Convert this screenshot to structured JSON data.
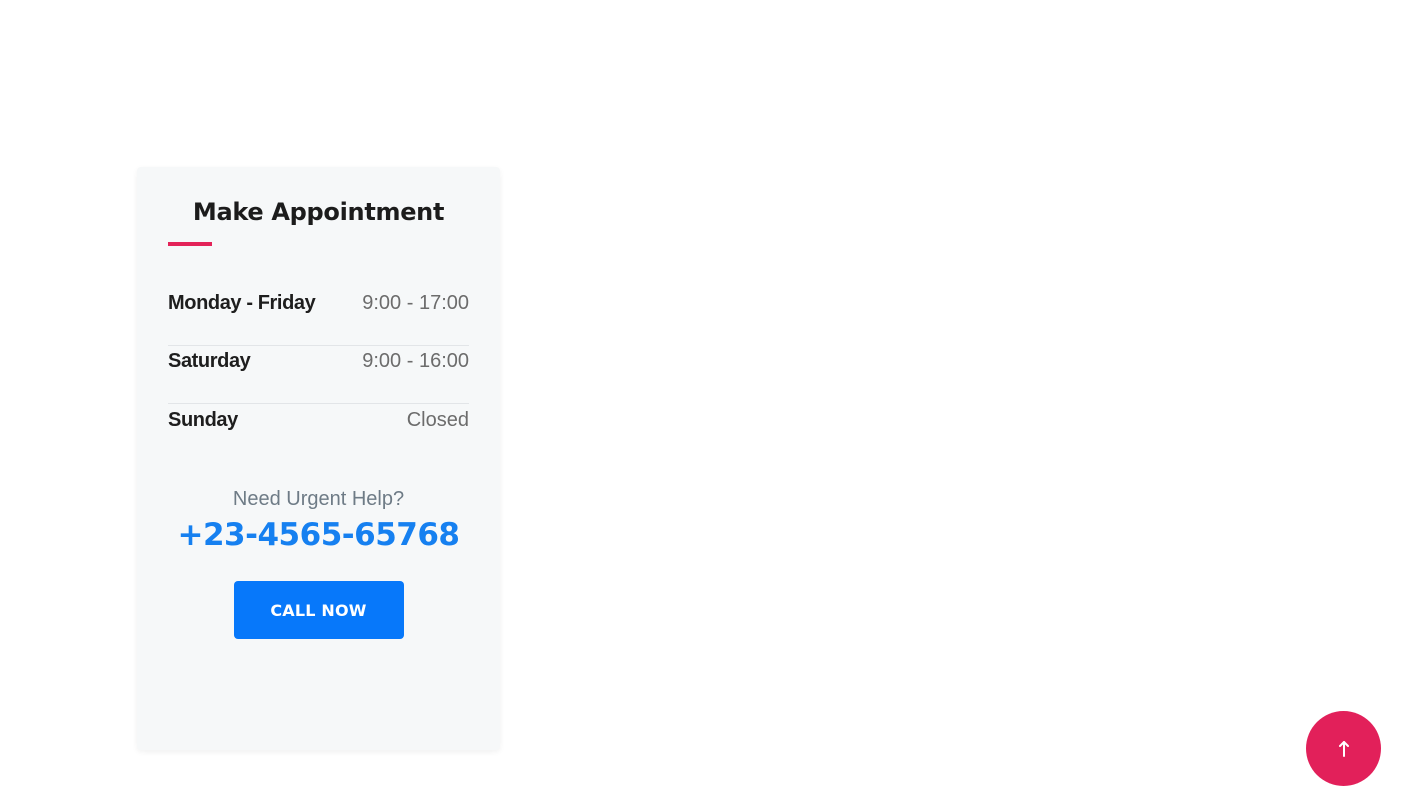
{
  "appointment": {
    "title": "Make Appointment",
    "accent_color": "#e32359",
    "hours": [
      {
        "day": "Monday - Friday",
        "time": "9:00 - 17:00"
      },
      {
        "day": "Saturday",
        "time": "9:00 - 16:00"
      },
      {
        "day": "Sunday",
        "time": "Closed"
      }
    ],
    "help_text": "Need Urgent Help?",
    "phone": "+23-4565-65768",
    "phone_color": "#1680f0",
    "call_button_label": "CALL NOW",
    "button_color": "#0778fa"
  },
  "scroll_top": {
    "icon": "arrow-up-icon",
    "color": "#e2205a"
  }
}
